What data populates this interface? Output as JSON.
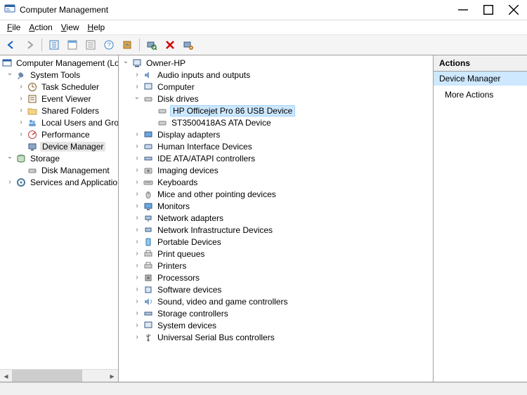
{
  "window": {
    "title": "Computer Management"
  },
  "menu": {
    "file": "File",
    "action": "Action",
    "view": "View",
    "help": "Help"
  },
  "left_tree": {
    "root": "Computer Management (Local",
    "system_tools": "System Tools",
    "task_scheduler": "Task Scheduler",
    "event_viewer": "Event Viewer",
    "shared_folders": "Shared Folders",
    "local_users": "Local Users and Groups",
    "performance": "Performance",
    "device_manager": "Device Manager",
    "storage": "Storage",
    "disk_management": "Disk Management",
    "services_apps": "Services and Applications"
  },
  "mid_tree": {
    "root": "Owner-HP",
    "audio": "Audio inputs and outputs",
    "computer": "Computer",
    "disk_drives": "Disk drives",
    "hp_officejet": "HP Officejet Pro 86 USB Device",
    "st_ata": "ST3500418AS ATA Device",
    "display_adapters": "Display adapters",
    "hid": "Human Interface Devices",
    "ide": "IDE ATA/ATAPI controllers",
    "imaging": "Imaging devices",
    "keyboards": "Keyboards",
    "mice": "Mice and other pointing devices",
    "monitors": "Monitors",
    "network_adapters": "Network adapters",
    "network_infra": "Network Infrastructure Devices",
    "portable": "Portable Devices",
    "print_queues": "Print queues",
    "printers": "Printers",
    "processors": "Processors",
    "software_devices": "Software devices",
    "sound": "Sound, video and game controllers",
    "storage_ctrl": "Storage controllers",
    "system_devices": "System devices",
    "usb": "Universal Serial Bus controllers"
  },
  "actions": {
    "header": "Actions",
    "category": "Device Manager",
    "more": "More Actions"
  },
  "colors": {
    "selection_blue": "#cde8ff",
    "selection_border": "#99d1ff"
  }
}
